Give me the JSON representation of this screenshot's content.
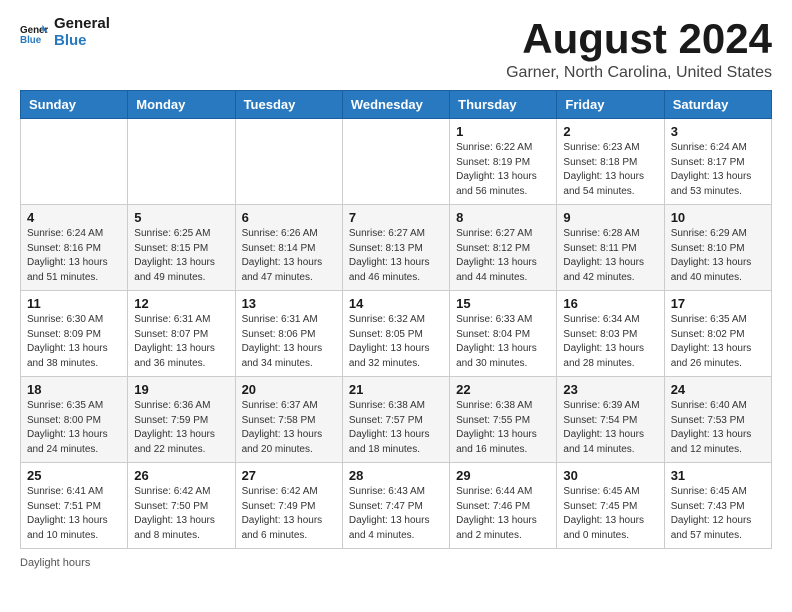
{
  "header": {
    "logo_line1": "General",
    "logo_line2": "Blue",
    "title": "August 2024",
    "subtitle": "Garner, North Carolina, United States"
  },
  "days_of_week": [
    "Sunday",
    "Monday",
    "Tuesday",
    "Wednesday",
    "Thursday",
    "Friday",
    "Saturday"
  ],
  "weeks": [
    [
      {
        "day": "",
        "info": ""
      },
      {
        "day": "",
        "info": ""
      },
      {
        "day": "",
        "info": ""
      },
      {
        "day": "",
        "info": ""
      },
      {
        "day": "1",
        "info": "Sunrise: 6:22 AM\nSunset: 8:19 PM\nDaylight: 13 hours\nand 56 minutes."
      },
      {
        "day": "2",
        "info": "Sunrise: 6:23 AM\nSunset: 8:18 PM\nDaylight: 13 hours\nand 54 minutes."
      },
      {
        "day": "3",
        "info": "Sunrise: 6:24 AM\nSunset: 8:17 PM\nDaylight: 13 hours\nand 53 minutes."
      }
    ],
    [
      {
        "day": "4",
        "info": "Sunrise: 6:24 AM\nSunset: 8:16 PM\nDaylight: 13 hours\nand 51 minutes."
      },
      {
        "day": "5",
        "info": "Sunrise: 6:25 AM\nSunset: 8:15 PM\nDaylight: 13 hours\nand 49 minutes."
      },
      {
        "day": "6",
        "info": "Sunrise: 6:26 AM\nSunset: 8:14 PM\nDaylight: 13 hours\nand 47 minutes."
      },
      {
        "day": "7",
        "info": "Sunrise: 6:27 AM\nSunset: 8:13 PM\nDaylight: 13 hours\nand 46 minutes."
      },
      {
        "day": "8",
        "info": "Sunrise: 6:27 AM\nSunset: 8:12 PM\nDaylight: 13 hours\nand 44 minutes."
      },
      {
        "day": "9",
        "info": "Sunrise: 6:28 AM\nSunset: 8:11 PM\nDaylight: 13 hours\nand 42 minutes."
      },
      {
        "day": "10",
        "info": "Sunrise: 6:29 AM\nSunset: 8:10 PM\nDaylight: 13 hours\nand 40 minutes."
      }
    ],
    [
      {
        "day": "11",
        "info": "Sunrise: 6:30 AM\nSunset: 8:09 PM\nDaylight: 13 hours\nand 38 minutes."
      },
      {
        "day": "12",
        "info": "Sunrise: 6:31 AM\nSunset: 8:07 PM\nDaylight: 13 hours\nand 36 minutes."
      },
      {
        "day": "13",
        "info": "Sunrise: 6:31 AM\nSunset: 8:06 PM\nDaylight: 13 hours\nand 34 minutes."
      },
      {
        "day": "14",
        "info": "Sunrise: 6:32 AM\nSunset: 8:05 PM\nDaylight: 13 hours\nand 32 minutes."
      },
      {
        "day": "15",
        "info": "Sunrise: 6:33 AM\nSunset: 8:04 PM\nDaylight: 13 hours\nand 30 minutes."
      },
      {
        "day": "16",
        "info": "Sunrise: 6:34 AM\nSunset: 8:03 PM\nDaylight: 13 hours\nand 28 minutes."
      },
      {
        "day": "17",
        "info": "Sunrise: 6:35 AM\nSunset: 8:02 PM\nDaylight: 13 hours\nand 26 minutes."
      }
    ],
    [
      {
        "day": "18",
        "info": "Sunrise: 6:35 AM\nSunset: 8:00 PM\nDaylight: 13 hours\nand 24 minutes."
      },
      {
        "day": "19",
        "info": "Sunrise: 6:36 AM\nSunset: 7:59 PM\nDaylight: 13 hours\nand 22 minutes."
      },
      {
        "day": "20",
        "info": "Sunrise: 6:37 AM\nSunset: 7:58 PM\nDaylight: 13 hours\nand 20 minutes."
      },
      {
        "day": "21",
        "info": "Sunrise: 6:38 AM\nSunset: 7:57 PM\nDaylight: 13 hours\nand 18 minutes."
      },
      {
        "day": "22",
        "info": "Sunrise: 6:38 AM\nSunset: 7:55 PM\nDaylight: 13 hours\nand 16 minutes."
      },
      {
        "day": "23",
        "info": "Sunrise: 6:39 AM\nSunset: 7:54 PM\nDaylight: 13 hours\nand 14 minutes."
      },
      {
        "day": "24",
        "info": "Sunrise: 6:40 AM\nSunset: 7:53 PM\nDaylight: 13 hours\nand 12 minutes."
      }
    ],
    [
      {
        "day": "25",
        "info": "Sunrise: 6:41 AM\nSunset: 7:51 PM\nDaylight: 13 hours\nand 10 minutes."
      },
      {
        "day": "26",
        "info": "Sunrise: 6:42 AM\nSunset: 7:50 PM\nDaylight: 13 hours\nand 8 minutes."
      },
      {
        "day": "27",
        "info": "Sunrise: 6:42 AM\nSunset: 7:49 PM\nDaylight: 13 hours\nand 6 minutes."
      },
      {
        "day": "28",
        "info": "Sunrise: 6:43 AM\nSunset: 7:47 PM\nDaylight: 13 hours\nand 4 minutes."
      },
      {
        "day": "29",
        "info": "Sunrise: 6:44 AM\nSunset: 7:46 PM\nDaylight: 13 hours\nand 2 minutes."
      },
      {
        "day": "30",
        "info": "Sunrise: 6:45 AM\nSunset: 7:45 PM\nDaylight: 13 hours\nand 0 minutes."
      },
      {
        "day": "31",
        "info": "Sunrise: 6:45 AM\nSunset: 7:43 PM\nDaylight: 12 hours\nand 57 minutes."
      }
    ]
  ],
  "footer": {
    "note": "Daylight hours"
  }
}
